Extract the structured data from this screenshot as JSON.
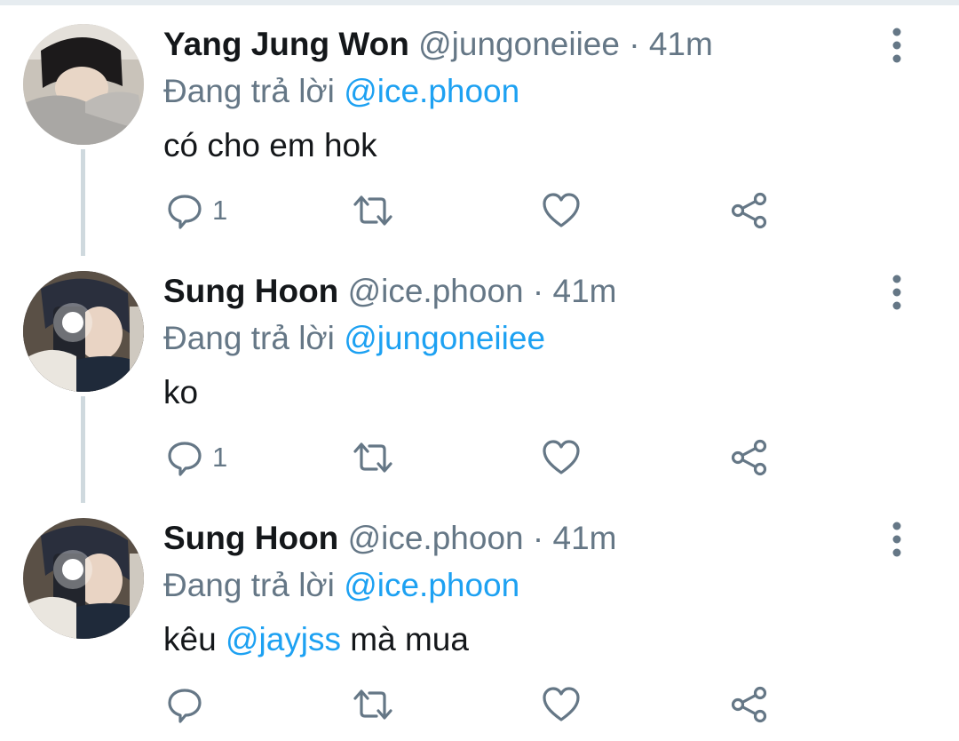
{
  "tweets": [
    {
      "name": "Yang Jung Won",
      "handle": "@jungoneiiee",
      "separator": "·",
      "time": "41m",
      "reply_prefix": "Đang trả lời",
      "reply_to": "@ice.phoon",
      "text": "có cho em hok",
      "reply_count": "1",
      "avatar": "avatar-yang-jung-won"
    },
    {
      "name": "Sung Hoon",
      "handle": "@ice.phoon",
      "separator": "·",
      "time": "41m",
      "reply_prefix": "Đang trả lời",
      "reply_to": "@jungoneiiee",
      "text": "ko",
      "reply_count": "1",
      "avatar": "avatar-sung-hoon"
    },
    {
      "name": "Sung Hoon",
      "handle": "@ice.phoon",
      "separator": "·",
      "time": "41m",
      "reply_prefix": "Đang trả lời",
      "reply_to": "@ice.phoon",
      "text_before": "kêu",
      "text_mention": "@jayjss",
      "text_after": "mà mua",
      "reply_count": "",
      "avatar": "avatar-sung-hoon"
    }
  ],
  "colors": {
    "accent": "#1da1f2",
    "secondary_text": "#657786",
    "primary_text": "#14171a",
    "thread_line": "#cfd9de"
  },
  "icons": [
    "reply-icon",
    "retweet-icon",
    "like-icon",
    "share-icon",
    "more-options-icon"
  ]
}
